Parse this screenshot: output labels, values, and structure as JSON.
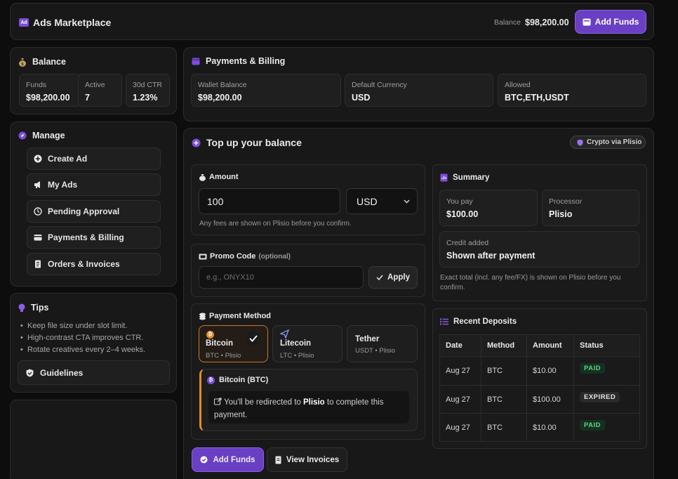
{
  "header": {
    "logo_icon": "ad-icon",
    "title": "Ads Marketplace",
    "balance_label": "Balance",
    "balance_value": "$98,200.00",
    "add_funds": "Add Funds"
  },
  "balance": {
    "title": "Balance",
    "funds_label": "Funds",
    "funds_value": "$98,200.00",
    "active_label": "Active",
    "active_value": "7",
    "ctr_label": "30d CTR",
    "ctr_value": "1.23%"
  },
  "manage": {
    "title": "Manage",
    "items": [
      {
        "label": "Create Ad",
        "icon": "plus-circle-icon"
      },
      {
        "label": "My Ads",
        "icon": "megaphone-icon"
      },
      {
        "label": "Pending Approval",
        "icon": "clock-icon"
      },
      {
        "label": "Payments & Billing",
        "icon": "wallet-icon"
      },
      {
        "label": "Orders & Invoices",
        "icon": "receipt-icon"
      }
    ]
  },
  "tips": {
    "title": "Tips",
    "items": [
      "Keep file size under slot limit.",
      "High-contrast CTA improves CTR.",
      "Rotate creatives every 2–4 weeks."
    ],
    "guidelines": "Guidelines"
  },
  "billing": {
    "title": "Payments & Billing",
    "wallet_label": "Wallet Balance",
    "wallet_value": "$98,200.00",
    "currency_label": "Default Currency",
    "currency_value": "USD",
    "allowed_label": "Allowed",
    "allowed_value": "BTC,ETH,USDT"
  },
  "topup": {
    "title": "Top up your balance",
    "badge": "Crypto via Plisio",
    "amount": {
      "label": "Amount",
      "value": "100",
      "currency": "USD",
      "hint": "Any fees are shown on Plisio before you confirm."
    },
    "promo": {
      "label": "Promo Code",
      "optional": "(optional)",
      "placeholder": "e.g., ONYX10",
      "apply": "Apply"
    },
    "method": {
      "label": "Payment Method",
      "options": [
        {
          "name": "Bitcoin",
          "sub": "BTC • Plisio",
          "selected": true
        },
        {
          "name": "Litecoin",
          "sub": "LTC • Plisio"
        },
        {
          "name": "Tether",
          "sub": "USDT • Plisio"
        }
      ],
      "notice_title": "Bitcoin (BTC)",
      "notice_text_1": "You'll be redirected to ",
      "notice_bold": "Plisio",
      "notice_text_2": " to complete this payment."
    },
    "actions": {
      "add_funds": "Add Funds",
      "view_invoices": "View Invoices"
    }
  },
  "summary": {
    "title": "Summary",
    "pay_label": "You pay",
    "pay_value": "$100.00",
    "processor_label": "Processor",
    "processor_value": "Plisio",
    "credit_label": "Credit added",
    "credit_value": "Shown after payment",
    "note": "Exact total (incl. any fee/FX) is shown on Plisio before you confirm."
  },
  "deposits": {
    "title": "Recent Deposits",
    "columns": [
      "Date",
      "Method",
      "Amount",
      "Status"
    ],
    "rows": [
      {
        "date": "Aug 27",
        "method": "BTC",
        "amount": "$10.00",
        "status": "PAID"
      },
      {
        "date": "Aug 27",
        "method": "BTC",
        "amount": "$100.00",
        "status": "EXPIRED"
      },
      {
        "date": "Aug 27",
        "method": "BTC",
        "amount": "$10.00",
        "status": "PAID"
      }
    ]
  },
  "colors": {
    "accent": "#6a3fc4",
    "orange": "#e58a2c",
    "paid": "#5fd18f",
    "expired": "#e6e6e6"
  }
}
